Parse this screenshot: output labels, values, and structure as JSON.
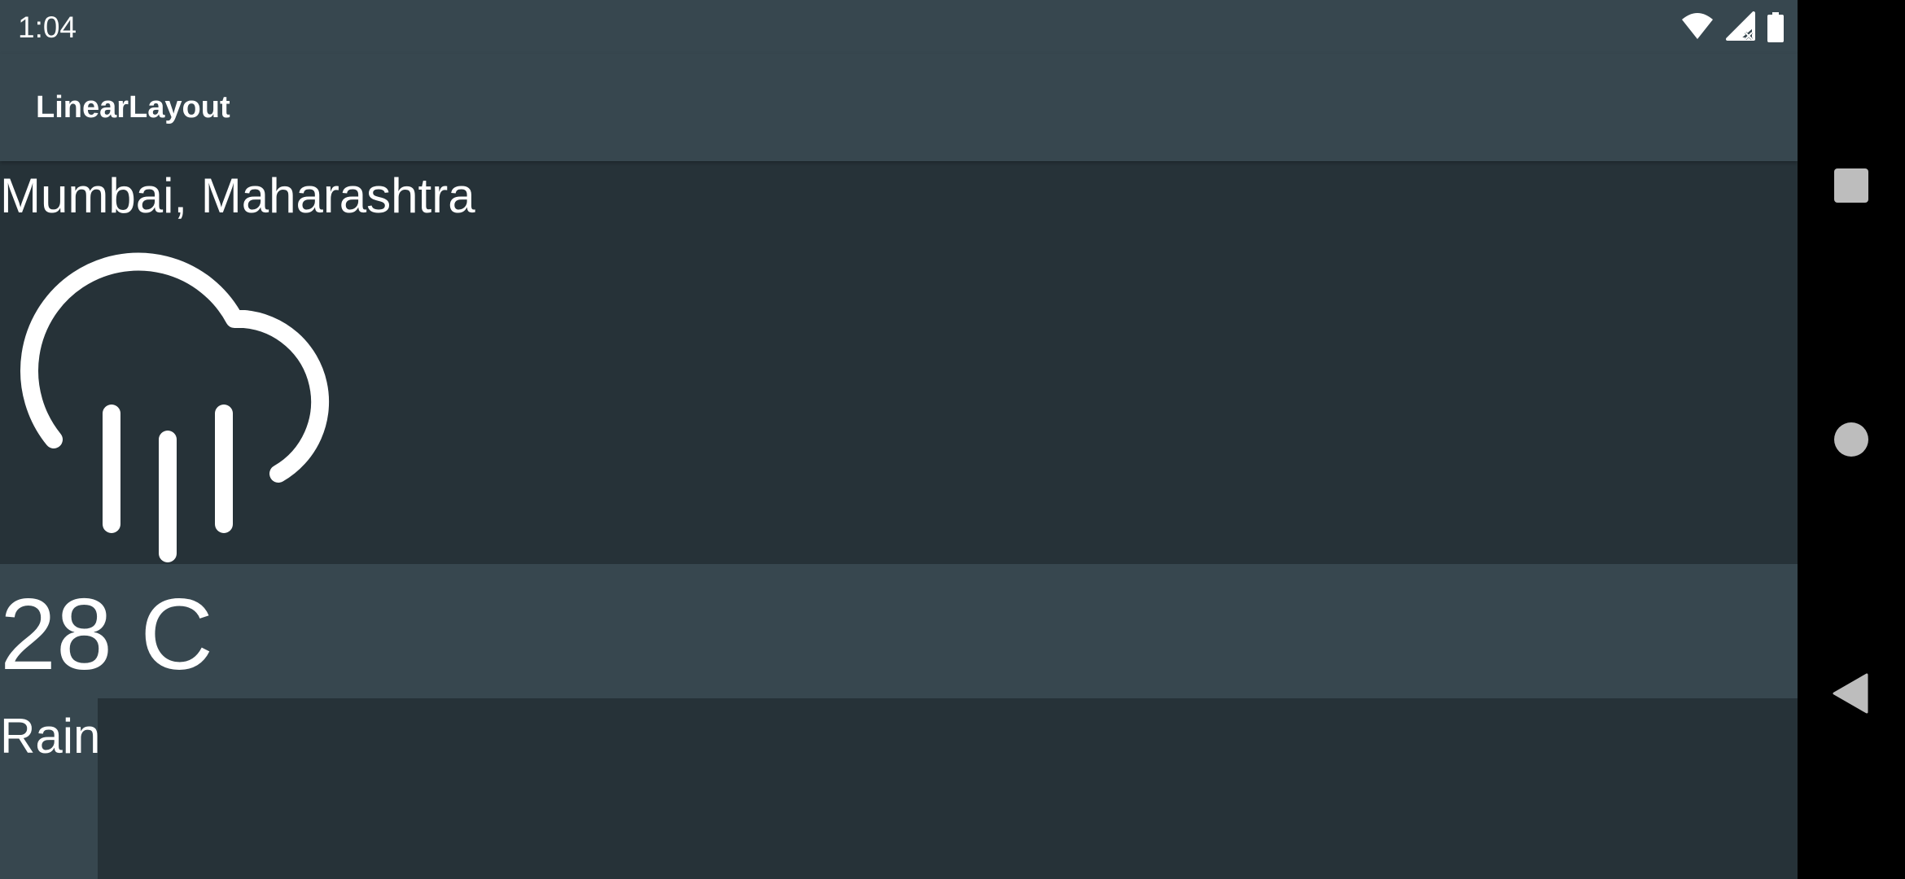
{
  "status_bar": {
    "time": "1:04",
    "icons": [
      "wifi-icon",
      "cell-signal-icon",
      "battery-icon"
    ]
  },
  "toolbar": {
    "title": "LinearLayout"
  },
  "weather": {
    "location": "Mumbai, Maharashtra",
    "icon": "rain-cloud-icon",
    "temperature": "28 C",
    "condition": "Rain"
  },
  "navigation_bar": {
    "buttons": [
      "recents-button",
      "home-button",
      "back-button"
    ]
  },
  "colors": {
    "primary": "#37474F",
    "background": "#263238",
    "text": "#FFFFFF",
    "nav_background": "#000000",
    "nav_icon": "#BDBDBD"
  }
}
